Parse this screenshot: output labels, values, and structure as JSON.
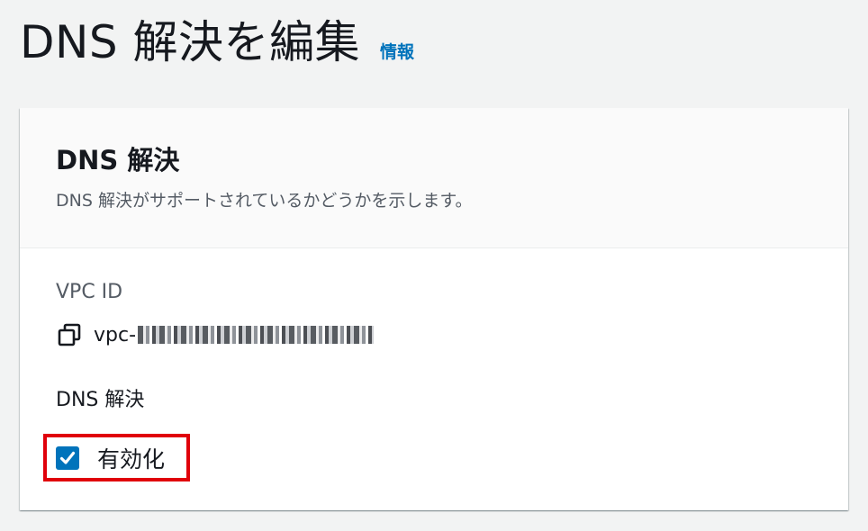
{
  "page": {
    "title": "DNS 解決を編集",
    "info_link": "情報"
  },
  "panel": {
    "title": "DNS 解決",
    "description": "DNS 解決がサポートされているかどうかを示します。"
  },
  "vpc": {
    "label": "VPC ID",
    "value_prefix": "vpc-",
    "copy_icon": "copy-icon"
  },
  "dns_resolution": {
    "label": "DNS 解決",
    "checkbox_label": "有効化",
    "checked": true
  },
  "colors": {
    "accent": "#0073bb",
    "highlight": "#e0000b",
    "background": "#f2f3f3"
  }
}
